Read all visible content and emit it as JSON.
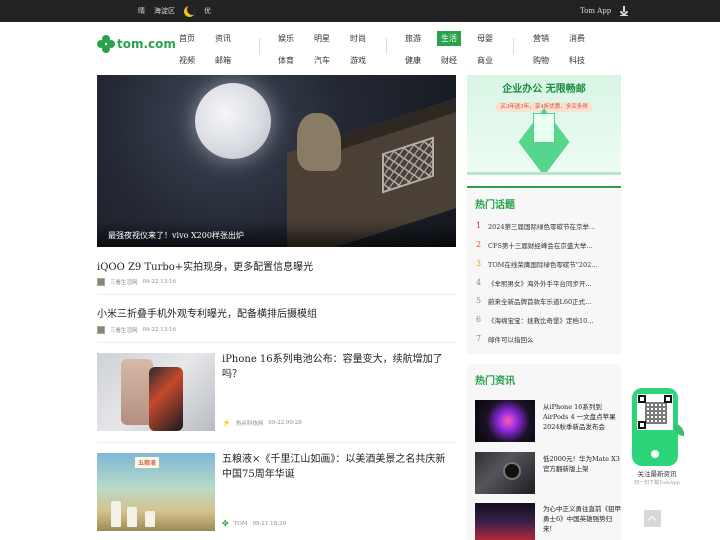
{
  "topbar": {
    "weather": "晴",
    "district": "海淀区",
    "air": "优",
    "app": "Tom App"
  },
  "logo": "tom.com",
  "nav": {
    "group1": [
      [
        "首页",
        "资讯"
      ],
      [
        "视频",
        "邮箱"
      ]
    ],
    "group2": [
      [
        "娱乐",
        "明星",
        "时尚"
      ],
      [
        "体育",
        "汽车",
        "游戏"
      ]
    ],
    "group3": [
      [
        "旅游",
        "生活",
        "母婴"
      ],
      [
        "健康",
        "财经",
        "商业"
      ]
    ],
    "group4": [
      [
        "营销",
        "消费"
      ],
      [
        "购物",
        "科技"
      ]
    ],
    "active": "生活"
  },
  "hero": {
    "caption": "最强夜视仪来了！vivo X200样张出炉"
  },
  "articles": [
    {
      "title": "iQOO Z9 Turbo+实拍现身，更多配置信息曝光",
      "source": "三看生活网",
      "time": "09-22 13:16"
    },
    {
      "title": "小米三折叠手机外观专利曝光，配备横排后摄模组",
      "source": "三看生活网",
      "time": "09-22 13:16"
    },
    {
      "title": "iPhone 16系列电池公布：容量变大，续航增加了吗？",
      "source": "热点科技网",
      "time": "09-22 09:28"
    },
    {
      "title": "五粮液×《千里江山如画》：以美酒美景之名共庆新中国75周年华诞",
      "source": "TOM",
      "time": "09-21 18:39",
      "thumb_text": "五粮液"
    }
  ],
  "ad": {
    "headline": "企业办公  无限畅邮",
    "pill": "买3年送3年，享4折优惠，多买多得"
  },
  "hot_topics": {
    "title": "热门话题",
    "items": [
      {
        "n": "1",
        "text": "2024第三届国际绿色零碳节在京举..."
      },
      {
        "n": "2",
        "text": "CFS第十三届财经峰会在京盛大举..."
      },
      {
        "n": "3",
        "text": "TOM在线荣膺国际绿色零碳节\"202..."
      },
      {
        "n": "4",
        "text": "《芈熙男女》海外外手平台同步开..."
      },
      {
        "n": "5",
        "text": "蔚来全新品牌首款车乐道L60正式..."
      },
      {
        "n": "6",
        "text": "《海绵宝宝：拯救比奇堡》定档10..."
      },
      {
        "n": "7",
        "text": "邮件可以指回么"
      }
    ]
  },
  "hot_news": {
    "title": "热门资讯",
    "items": [
      {
        "text": "从iPhone 16系列到AirPods 4 一文盘点苹果2024秋季新品发布会"
      },
      {
        "text": "低2000元！华为Mate X3官方翻新版上架"
      },
      {
        "text": "为心中正义勇往直前《狙甲勇士6》中国英雄强势归来!"
      }
    ]
  },
  "qr": {
    "label": "关注最新资讯",
    "sub": "扫一扫下载TomApp"
  }
}
